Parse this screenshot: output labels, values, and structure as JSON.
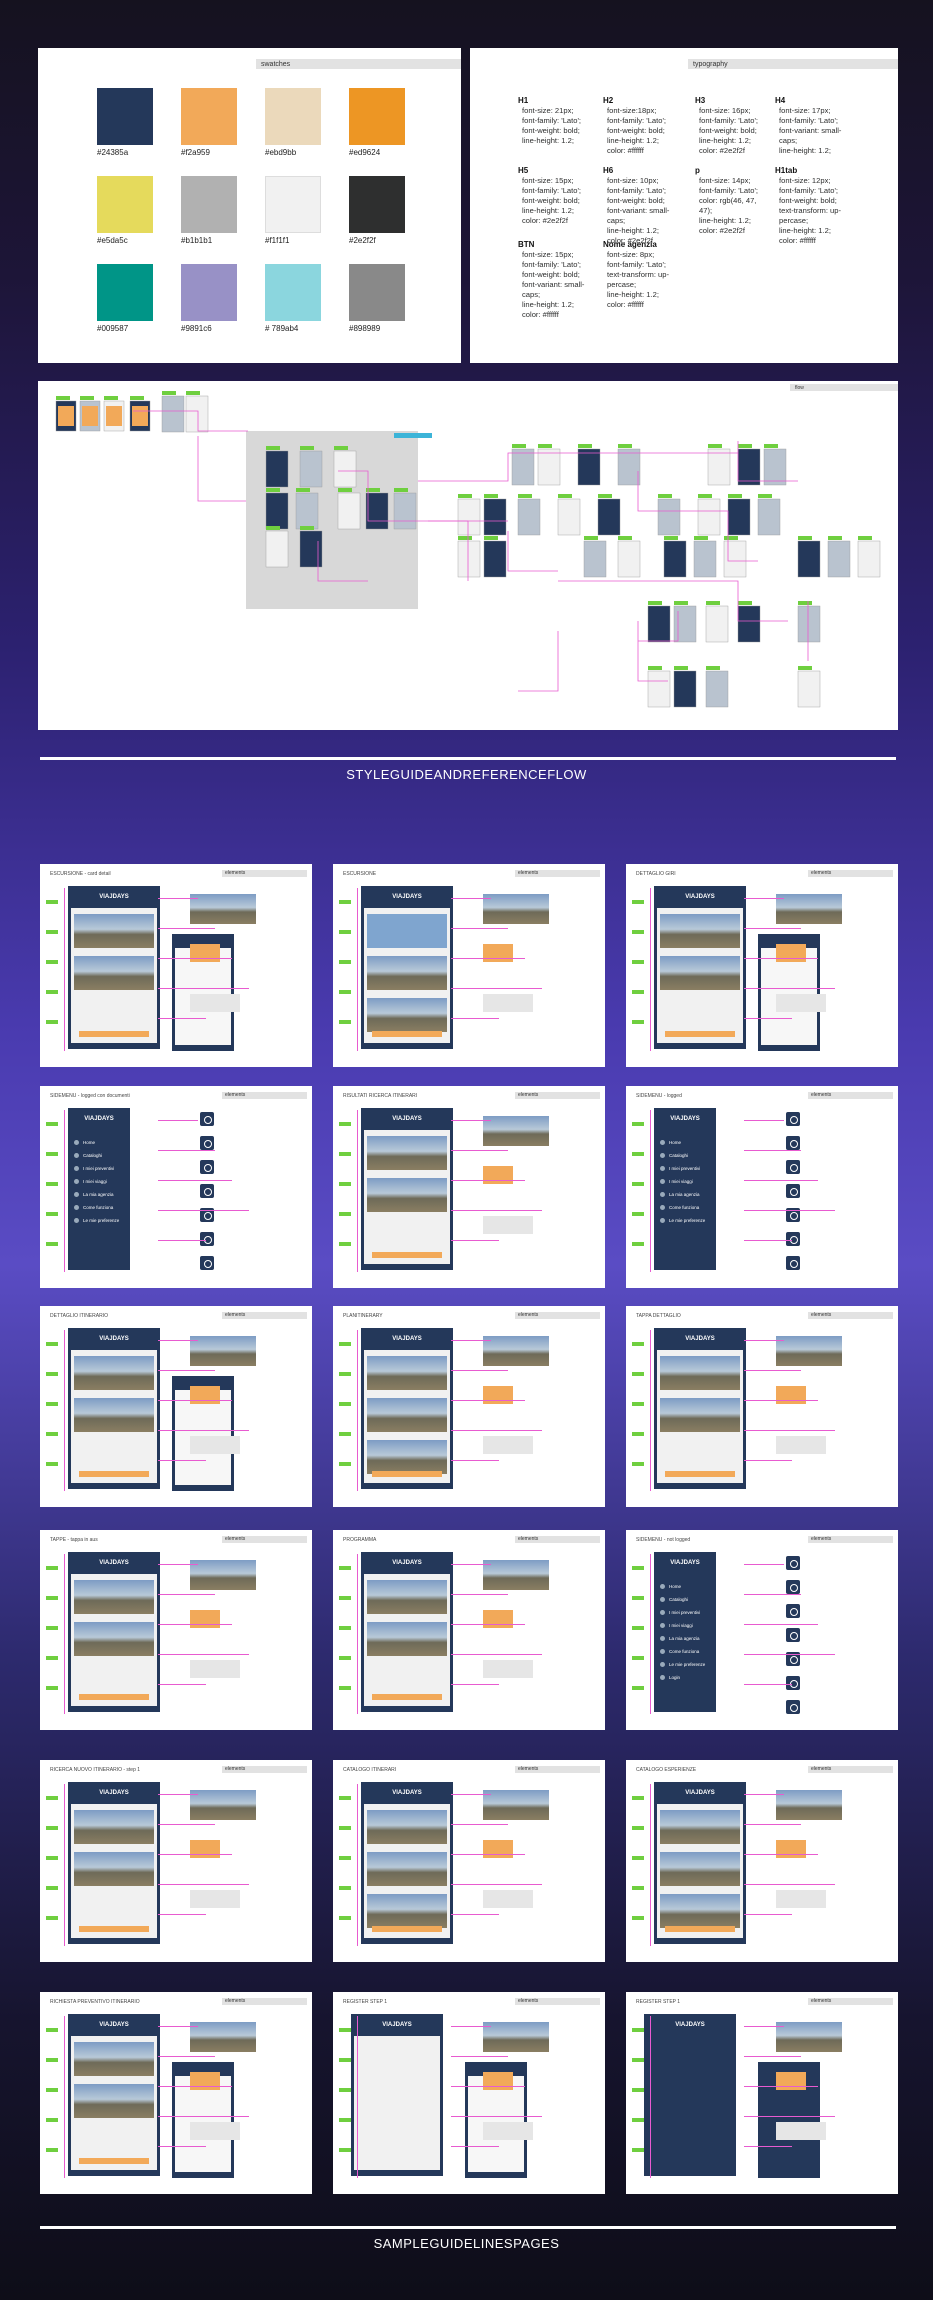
{
  "swatches": {
    "title": "swatches",
    "colors": [
      {
        "hex": "#24385a",
        "label": "#24385a"
      },
      {
        "hex": "#f2a959",
        "label": "#f2a959"
      },
      {
        "hex": "#ebd9bb",
        "label": "#ebd9bb"
      },
      {
        "hex": "#ed9624",
        "label": "#ed9624"
      },
      {
        "hex": "#e5da5c",
        "label": "#e5da5c"
      },
      {
        "hex": "#b1b1b1",
        "label": "#b1b1b1"
      },
      {
        "hex": "#f1f1f1",
        "label": "#f1f1f1"
      },
      {
        "hex": "#2e2f2f",
        "label": "#2e2f2f"
      },
      {
        "hex": "#009587",
        "label": "#009587"
      },
      {
        "hex": "#9891c6",
        "label": "#9891c6"
      },
      {
        "hex": "#8bd6de",
        "label": "# 789ab4"
      },
      {
        "hex": "#898989",
        "label": "#898989"
      }
    ]
  },
  "typography": {
    "title": "typography",
    "items": [
      {
        "name": "H1",
        "body": "font-size: 21px;\nfont-family: 'Lato';\nfont-weight: bold;\nline-height: 1.2;"
      },
      {
        "name": "H2",
        "body": "font-size:18px;\nfont-family: 'Lato';\nfont-weight: bold;\nline-height: 1.2;\ncolor: #ffffff"
      },
      {
        "name": "H3",
        "body": "font-size: 16px;\nfont-family: 'Lato';\nfont-weight: bold;\nline-height: 1.2;\ncolor: #2e2f2f"
      },
      {
        "name": "H4",
        "body": "font-size: 17px;\nfont-family: 'Lato';\nfont-variant: small-\ncaps;\nline-height: 1.2;"
      },
      {
        "name": "H5",
        "body": "font-size: 15px;\nfont-family: 'Lato';\nfont-weight: bold;\nline-height: 1.2;\ncolor: #2e2f2f"
      },
      {
        "name": "H6",
        "body": "font-size: 10px;\nfont-family: 'Lato';\nfont-weight: bold;\nfont-variant: small-\ncaps;\nline-height: 1.2;\ncolor: #2e2f2f"
      },
      {
        "name": "p",
        "body": "font-size: 14px;\nfont-family: 'Lato';\ncolor: rgb(46, 47,\n47);\nline-height: 1.2;\ncolor: #2e2f2f"
      },
      {
        "name": "H1tab",
        "body": "font-size: 12px;\nfont-family: 'Lato';\nfont-weight: bold;\ntext-transform: up-\npercase;\nline-height: 1.2;\ncolor: #ffffff"
      },
      {
        "name": "BTN",
        "body": "font-size: 15px;\nfont-family: 'Lato';\nfont-weight: bold;\nfont-variant: small-\ncaps;\nline-height: 1.2;\ncolor: #ffffff"
      },
      {
        "name": "Nome agenzia",
        "body": "font-size: 8px;\nfont-family: 'Lato';\ntext-transform: up-\npercase;\nline-height: 1.2;\ncolor: #ffffff"
      }
    ]
  },
  "flow": {
    "title": "flow"
  },
  "section1_title": "STYLEGUIDEANDREFERENCEFLOW",
  "section2_title": "SAMPLEGUIDELINESPAGES",
  "brand": "VIAJDAYS",
  "pages": [
    {
      "title": "ESCURSIONE - card detail",
      "header": "elements"
    },
    {
      "title": "ESCURSIONE",
      "header": "elements"
    },
    {
      "title": "DETTAGLIO GIRI",
      "header": "elements"
    },
    {
      "title": "SIDEMENU - logged con documenti",
      "header": "elements"
    },
    {
      "title": "RISULTATI RICERCA ITINERARI",
      "header": "elements"
    },
    {
      "title": "SIDEMENU - logged",
      "header": "elements"
    },
    {
      "title": "DETTAGLIO ITINERARIO",
      "header": "elements"
    },
    {
      "title": "PLANITINERARY",
      "header": "elements"
    },
    {
      "title": "TAPPA DETTAGLIO",
      "header": "elements"
    },
    {
      "title": "TAPPE - tappa in aus",
      "header": "elements"
    },
    {
      "title": "PROGRAMMA",
      "header": "elements"
    },
    {
      "title": "SIDEMENU - not logged",
      "header": "elements"
    },
    {
      "title": "RICERCA NUOVO ITINERARIO - step 1",
      "header": "elements"
    },
    {
      "title": "CATALOGO ITINERARI",
      "header": "elements"
    },
    {
      "title": "CATALOGO ESPERIENZE",
      "header": "elements"
    },
    {
      "title": "RICHIESTA PREVENTIVO ITINERARIO",
      "header": "elements"
    },
    {
      "title": "REGISTER STEP 1",
      "header": "elements"
    },
    {
      "title": "REGISTER STEP 1",
      "header": "elements"
    }
  ],
  "menu_items": [
    "Home",
    "Cataloghi",
    "I miei preventivi",
    "I miei viaggi",
    "La mia agenzia",
    "Come funziona",
    "Le mie preferenze",
    "Login"
  ]
}
